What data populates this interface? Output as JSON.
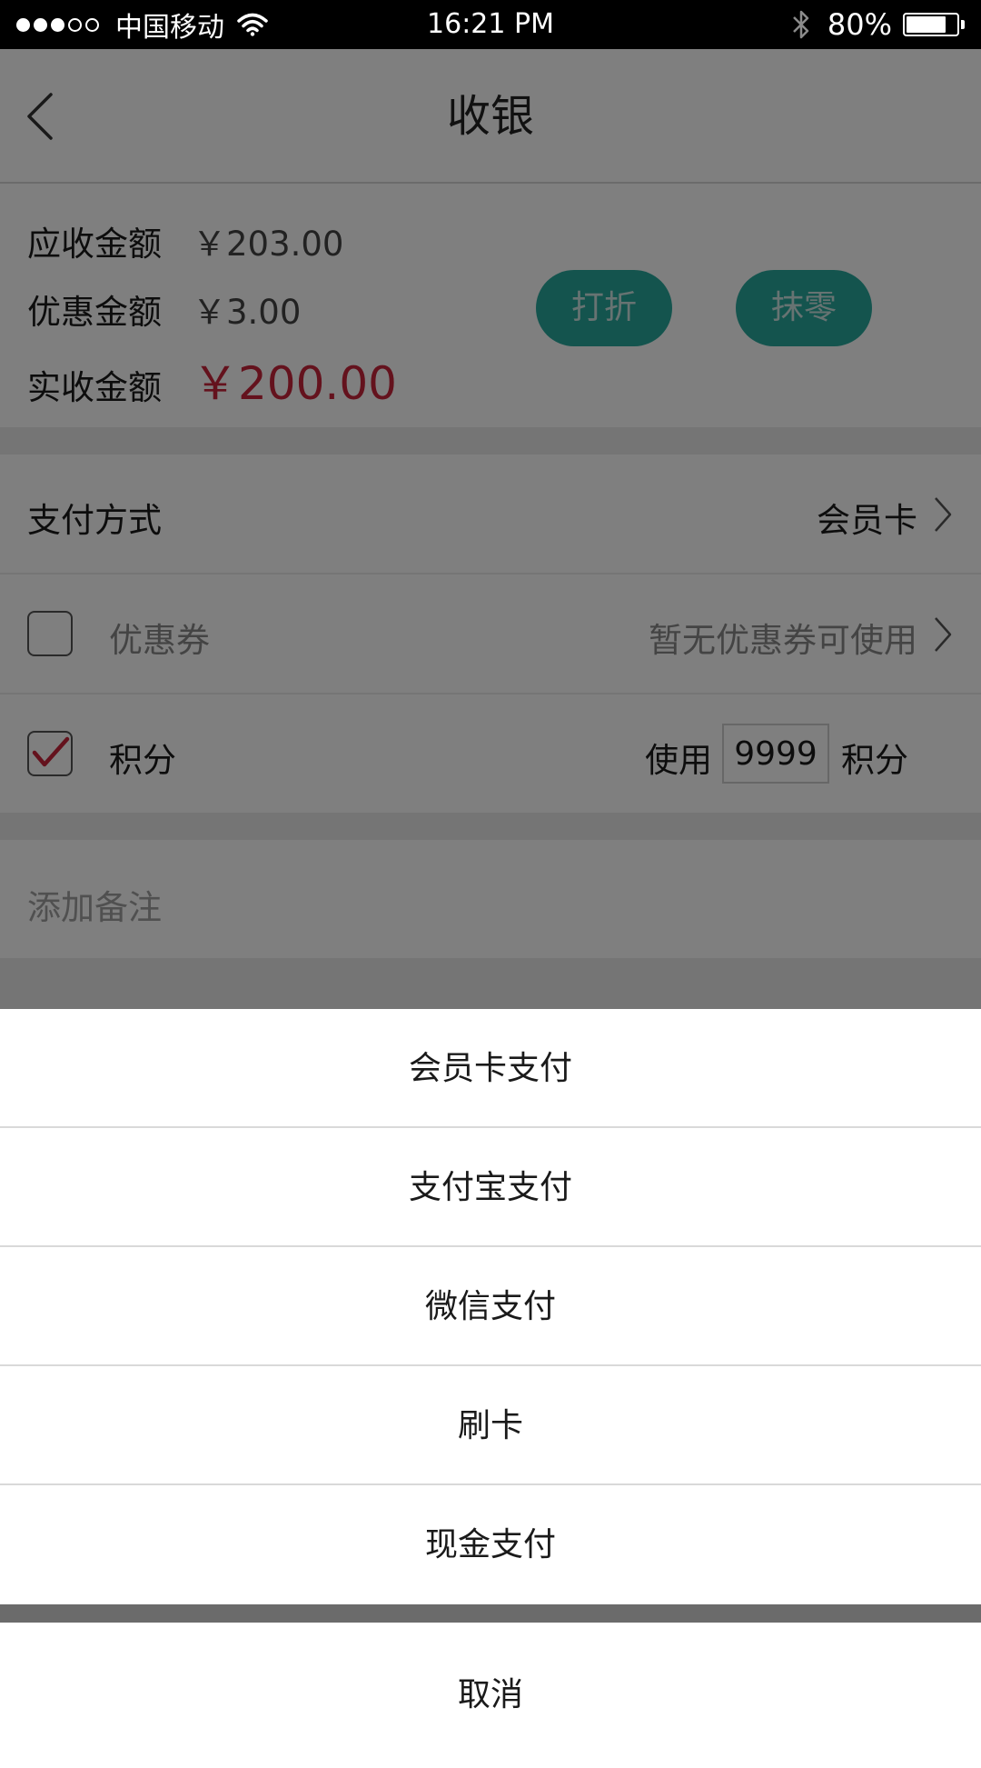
{
  "status_bar": {
    "carrier": "中国移动",
    "time": "16:21 PM",
    "battery_percent": "80%",
    "battery_level": 0.8,
    "signal_bars_filled": 3,
    "signal_bars_total": 5
  },
  "navbar": {
    "title": "收银",
    "back_icon": "chevron-left-icon"
  },
  "amounts": {
    "receivable_label": "应收金额",
    "receivable_value": "￥203.00",
    "discount_label": "优惠金额",
    "discount_value": "￥3.00",
    "actual_label": "实收金额",
    "actual_value": "￥200.00",
    "discount_button": "打折",
    "round_off_button": "抹零"
  },
  "payment_method": {
    "label": "支付方式",
    "value": "会员卡"
  },
  "coupon": {
    "label": "优惠券",
    "status": "暂无优惠券可使用",
    "checked": false
  },
  "points": {
    "label": "积分",
    "checked": true,
    "use_label": "使用",
    "value": "9999",
    "unit_label": "积分"
  },
  "remark": {
    "placeholder": "添加备注"
  },
  "action_sheet": {
    "options": [
      "会员卡支付",
      "支付宝支付",
      "微信支付",
      "刷卡",
      "现金支付"
    ],
    "cancel": "取消"
  },
  "colors": {
    "accent_teal": "#29a89d",
    "amount_red": "#c8243a",
    "check_red": "#c8243a"
  }
}
